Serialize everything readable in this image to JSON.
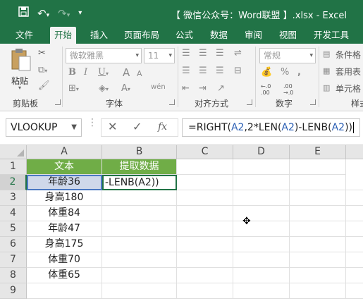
{
  "titlebar": {
    "save_icon": "save-icon",
    "undo_icon": "undo-icon",
    "redo_icon": "redo-icon",
    "customize_icon": "customize-qat-icon",
    "title": "【 微信公众号：Word联盟 】.xlsx - Excel"
  },
  "tabs": [
    "文件",
    "开始",
    "插入",
    "页面布局",
    "公式",
    "数据",
    "审阅",
    "视图",
    "开发工具"
  ],
  "active_tab": "开始",
  "ribbon": {
    "clipboard": {
      "label": "剪贴板",
      "paste": "粘贴"
    },
    "font": {
      "label": "字体",
      "font_name": "微软雅黑",
      "font_size": "11",
      "bold": "B",
      "italic": "I",
      "underline": "U",
      "font_a_large": "A",
      "font_a_small": "A",
      "wen": "wén"
    },
    "alignment": {
      "label": "对齐方式"
    },
    "number": {
      "label": "数字",
      "format": "常规",
      "percent": "%",
      "comma": ",",
      "inc_dec": "←.0 .00",
      "dec_dec": ".00 →.0"
    },
    "styles": {
      "label": "样式",
      "conditional": "条件格",
      "table": "套用表",
      "cell": "单元格"
    }
  },
  "formula_bar": {
    "name_box": "VLOOKUP",
    "cancel": "✕",
    "enter": "✓",
    "fx": "fx",
    "formula_parts": [
      "=RIGHT(",
      "A2",
      ",2*LEN(",
      "A2",
      ")-LENB(",
      "A2",
      "))"
    ]
  },
  "sheet": {
    "columns": [
      "A",
      "B",
      "C",
      "D",
      "E"
    ],
    "rows": [
      "1",
      "2",
      "3",
      "4",
      "5",
      "6",
      "7",
      "8",
      "9"
    ],
    "header_a": "文本",
    "header_b": "提取数据",
    "col_a_values": [
      "年龄36",
      "身高180",
      "体重84",
      "年龄47",
      "身高175",
      "体重70",
      "体重65"
    ],
    "b2_editing": "-LENB(A2))"
  },
  "colors": {
    "accent": "#217346",
    "header_fill": "#70ad47",
    "ref_blue": "#2b5fb4"
  }
}
